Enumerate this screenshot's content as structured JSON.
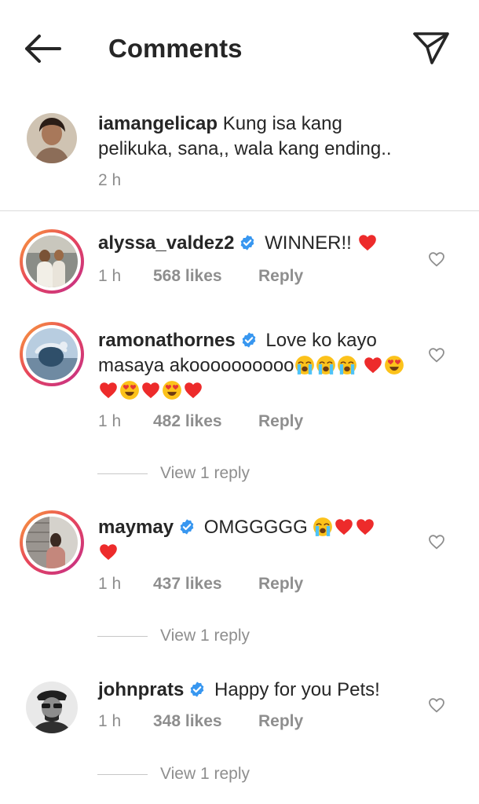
{
  "header": {
    "title": "Comments"
  },
  "colors": {
    "verified_blue": "#3897f0",
    "heart_red": "#ed2b2b",
    "meta_gray": "#8e8e8e"
  },
  "icons": {
    "back": "arrow-left-icon",
    "direct": "paper-plane-icon",
    "like": "heart-outline-icon"
  },
  "caption": {
    "username": "iamangelicap",
    "text": "Kung isa kang pelikuka, sana,, wala kang ending..",
    "time": "2 h"
  },
  "comments": [
    {
      "username": "alyssa_valdez2",
      "verified": true,
      "text": "WINNER!!",
      "emojis": [
        "red-heart"
      ],
      "time": "1 h",
      "likes": "568 likes",
      "reply": "Reply"
    },
    {
      "username": "ramonathornes",
      "verified": true,
      "text": "Love ko kayo masaya akoooooooooo",
      "emojis": [
        "loudly-crying-face",
        "loudly-crying-face",
        "loudly-crying-face",
        "red-heart",
        "heart-eyes",
        "red-heart",
        "heart-eyes",
        "red-heart",
        "heart-eyes",
        "red-heart"
      ],
      "time": "1 h",
      "likes": "482 likes",
      "reply": "Reply",
      "view_replies": "View 1 reply"
    },
    {
      "username": "maymay",
      "verified": true,
      "text": "OMGGGGG",
      "emojis": [
        "loudly-crying-face",
        "red-heart",
        "red-heart",
        "red-heart"
      ],
      "time": "1 h",
      "likes": "437 likes",
      "reply": "Reply",
      "view_replies": "View 1 reply"
    },
    {
      "username": "johnprats",
      "verified": true,
      "text": "Happy for you Pets!",
      "emojis": [],
      "time": "1 h",
      "likes": "348 likes",
      "reply": "Reply",
      "view_replies": "View 1 reply"
    }
  ]
}
